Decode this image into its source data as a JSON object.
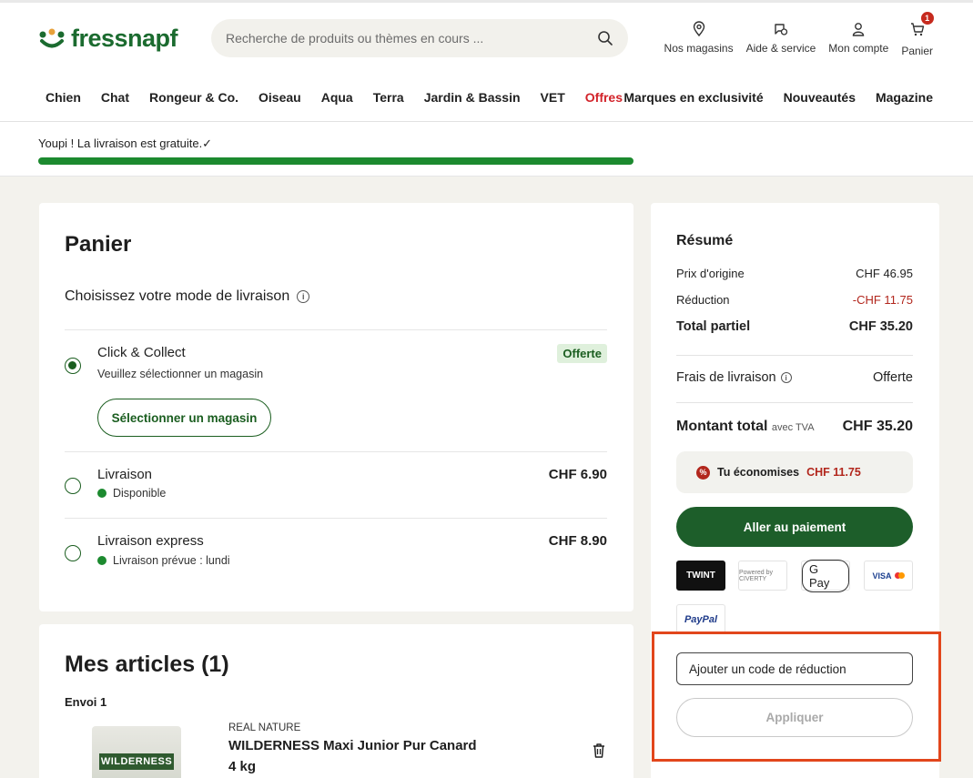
{
  "header": {
    "logo_text": "fressnapf",
    "search_placeholder": "Recherche de produits ou thèmes en cours ...",
    "utils": {
      "stores": "Nos magasins",
      "help": "Aide & service",
      "account": "Mon compte",
      "cart": "Panier",
      "cart_count": "1"
    },
    "nav": [
      "Chien",
      "Chat",
      "Rongeur & Co.",
      "Oiseau",
      "Aqua",
      "Terra",
      "Jardin & Bassin",
      "VET",
      "Offres"
    ],
    "nav_right": [
      "Marques en exclusivité",
      "Nouveautés",
      "Magazine"
    ]
  },
  "shipping": {
    "message": "Youpi ! La livraison est gratuite.✓",
    "progress_fraction": 1.0
  },
  "cart": {
    "title": "Panier",
    "mode_title": "Choisissez votre mode de livraison",
    "options": [
      {
        "title": "Click & Collect",
        "sub": "Veuillez sélectionner un magasin",
        "badge": "Offerte",
        "button": "Sélectionner un magasin",
        "selected": true
      },
      {
        "title": "Livraison",
        "sub": "Disponible",
        "price": "CHF 6.90",
        "selected": false
      },
      {
        "title": "Livraison express",
        "sub": "Livraison prévue : lundi",
        "price": "CHF 8.90",
        "selected": false
      }
    ]
  },
  "items": {
    "title": "Mes articles (1)",
    "shipment": "Envoi 1",
    "product": {
      "brand": "REAL NATURE",
      "name": "WILDERNESS Maxi Junior Pur Canard",
      "size": "4 kg",
      "package_label": "WILDERNESS"
    }
  },
  "summary": {
    "title": "Résumé",
    "original_label": "Prix d'origine",
    "original_value": "CHF 46.95",
    "discount_label": "Réduction",
    "discount_value": "-CHF 11.75",
    "subtotal_label": "Total partiel",
    "subtotal_value": "CHF 35.20",
    "shipping_label": "Frais de livraison",
    "shipping_value": "Offerte",
    "total_label": "Montant total",
    "total_note": "avec TVA",
    "total_value": "CHF 35.20",
    "savings_label": "Tu économises",
    "savings_value": "CHF 11.75",
    "checkout_label": "Aller au paiement",
    "payment_logos": [
      "TWINT",
      "Powered by CIVERTY",
      "G Pay",
      "VISA",
      "PayPal"
    ],
    "promo_placeholder": "Ajouter un code de réduction",
    "apply_label": "Appliquer"
  },
  "colors": {
    "brand_green": "#1d5e2a",
    "offer_red": "#d2232a",
    "discount_red": "#b2261c",
    "highlight_orange": "#e2461c"
  }
}
